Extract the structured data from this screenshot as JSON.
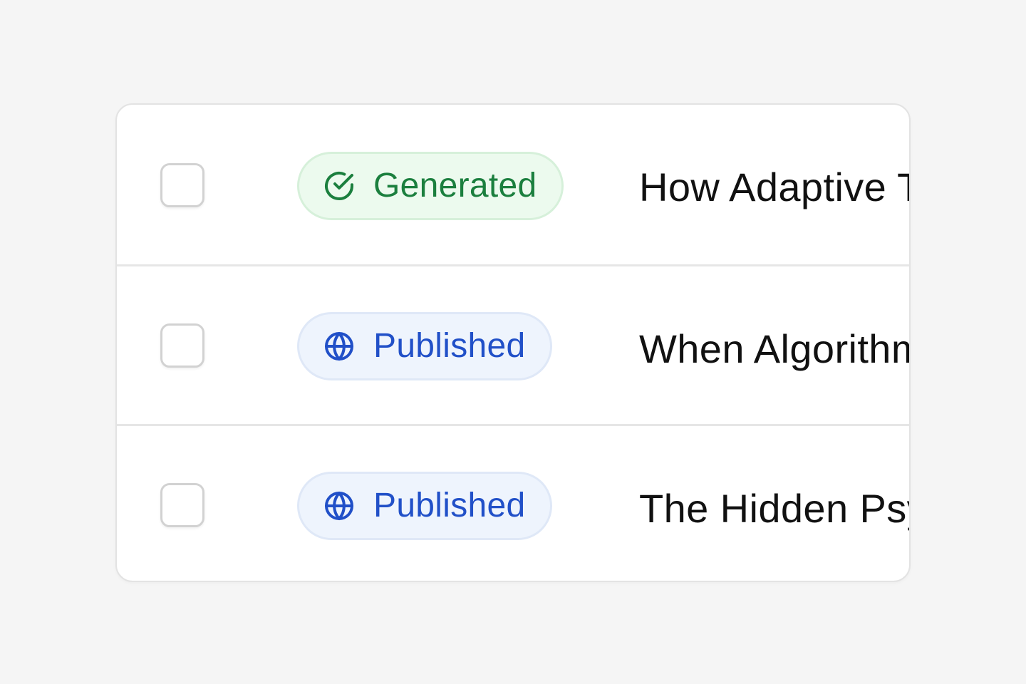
{
  "rows": [
    {
      "status": {
        "label": "Generated",
        "icon": "check-circle-icon",
        "color": "#1b7f3e",
        "background": "#ecfaee"
      },
      "title": "How Adaptive T"
    },
    {
      "status": {
        "label": "Published",
        "icon": "globe-icon",
        "color": "#2150c8",
        "background": "#eef4fd"
      },
      "title": "When Algorithm"
    },
    {
      "status": {
        "label": "Published",
        "icon": "globe-icon",
        "color": "#2150c8",
        "background": "#eef4fd"
      },
      "title": "The Hidden Psy"
    }
  ]
}
